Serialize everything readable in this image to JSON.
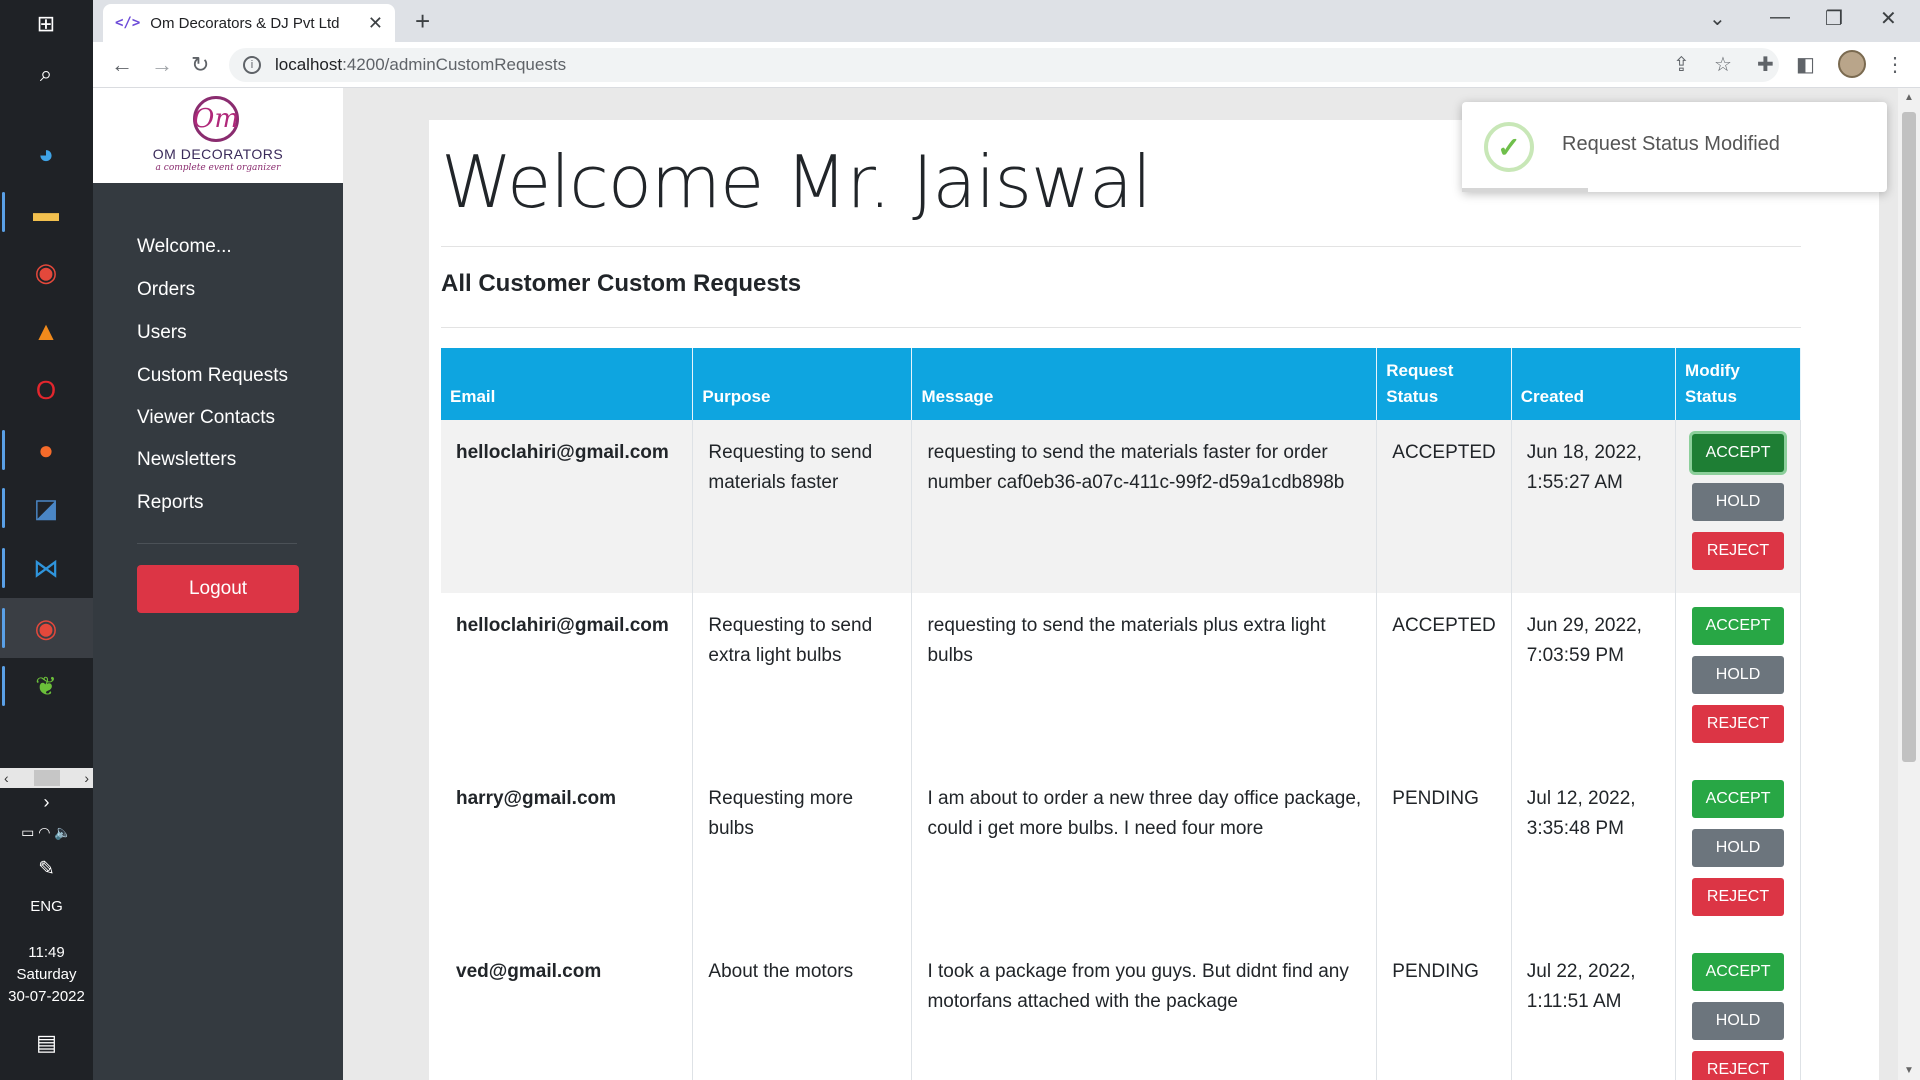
{
  "taskbar": {
    "time": "11:49",
    "day": "Saturday",
    "date": "30-07-2022",
    "lang": "ENG"
  },
  "browser": {
    "tab_title": "Om Decorators & DJ Pvt Ltd",
    "url_host": "localhost",
    "url_path": ":4200/adminCustomRequests"
  },
  "brand": {
    "logo_glyph": "Om",
    "name": "OM DECORATORS",
    "tagline": "a complete event organizer"
  },
  "sidebar": {
    "items": [
      {
        "label": "Welcome..."
      },
      {
        "label": "Orders"
      },
      {
        "label": "Users"
      },
      {
        "label": "Custom Requests"
      },
      {
        "label": "Viewer Contacts"
      },
      {
        "label": "Newsletters"
      },
      {
        "label": "Reports"
      }
    ],
    "logout_label": "Logout"
  },
  "main": {
    "welcome": "Welcome Mr. Jaiswal",
    "subtitle": "All Customer Custom Requests",
    "columns": [
      "Email",
      "Purpose",
      "Message",
      "Request Status",
      "Created",
      "Modify Status"
    ],
    "actions": {
      "accept": "ACCEPT",
      "hold": "HOLD",
      "reject": "REJECT"
    },
    "rows": [
      {
        "email": "helloclahiri@gmail.com",
        "purpose": "Requesting to send materials faster",
        "message": "requesting to send the materials faster for order number caf0eb36-a07c-411c-99f2-d59a1cdb898b",
        "status": "ACCEPTED",
        "created": "Jun 18, 2022, 1:55:27 AM"
      },
      {
        "email": "helloclahiri@gmail.com",
        "purpose": "Requesting to send extra light bulbs",
        "message": "requesting to send the materials plus extra light bulbs",
        "status": "ACCEPTED",
        "created": "Jun 29, 2022, 7:03:59 PM"
      },
      {
        "email": "harry@gmail.com",
        "purpose": "Requesting more bulbs",
        "message": "I am about to order a new three day office package, could i get more bulbs. I need four more",
        "status": "PENDING",
        "created": "Jul 12, 2022, 3:35:48 PM"
      },
      {
        "email": "ved@gmail.com",
        "purpose": "About the motors",
        "message": "I took a package from you guys. But didnt find any motorfans attached with the package",
        "status": "PENDING",
        "created": "Jul 22, 2022, 1:11:51 AM"
      }
    ]
  },
  "toast": {
    "message": "Request Status Modified"
  },
  "colors": {
    "table_header": "#0ea5e0",
    "accept": "#28a745",
    "hold": "#6c757d",
    "reject": "#dc3545",
    "sidebar": "#343a40"
  }
}
